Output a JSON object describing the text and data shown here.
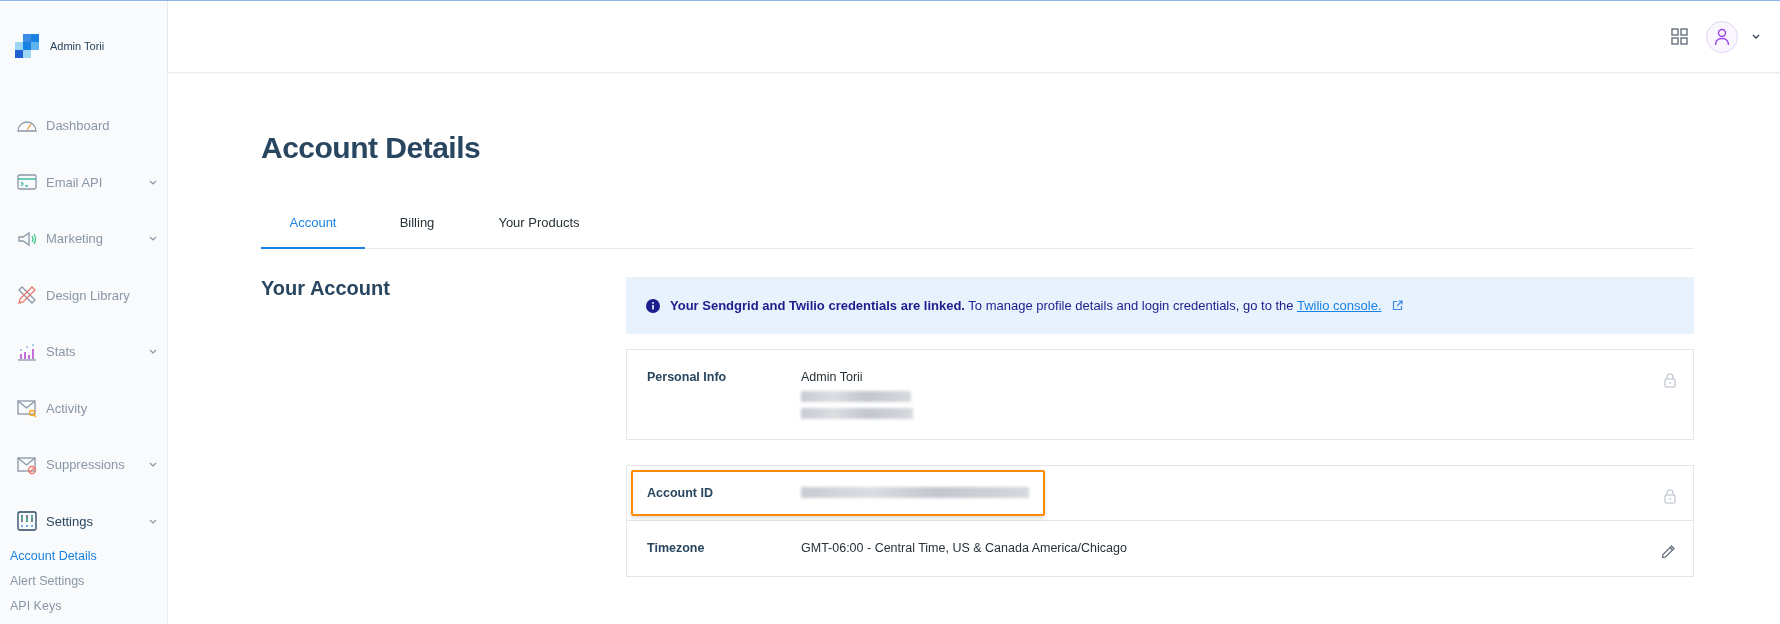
{
  "brand": {
    "name": "Admin Torii"
  },
  "sidebar": {
    "items": [
      {
        "label": "Dashboard",
        "expandable": false,
        "expanded": false
      },
      {
        "label": "Email API",
        "expandable": true,
        "expanded": false
      },
      {
        "label": "Marketing",
        "expandable": true,
        "expanded": false
      },
      {
        "label": "Design Library",
        "expandable": false,
        "expanded": false
      },
      {
        "label": "Stats",
        "expandable": true,
        "expanded": false
      },
      {
        "label": "Activity",
        "expandable": false,
        "expanded": false
      },
      {
        "label": "Suppressions",
        "expandable": true,
        "expanded": false
      },
      {
        "label": "Settings",
        "expandable": true,
        "expanded": true,
        "children": [
          {
            "label": "Account Details",
            "selected": true
          },
          {
            "label": "Alert Settings",
            "selected": false
          },
          {
            "label": "API Keys",
            "selected": false
          }
        ]
      }
    ]
  },
  "page": {
    "title": "Account Details"
  },
  "tabs": [
    {
      "label": "Account",
      "selected": true
    },
    {
      "label": "Billing",
      "selected": false
    },
    {
      "label": "Your Products",
      "selected": false
    }
  ],
  "section": {
    "title": "Your Account"
  },
  "banner": {
    "bold": "Your Sendgrid and Twilio credentials are linked.",
    "text": "To manage profile details and login credentials, go to the",
    "link": "Twilio console."
  },
  "cards": [
    {
      "rows": [
        {
          "label": "Personal Info",
          "lines": [
            "Admin Torii"
          ],
          "kind": "locked",
          "highlighted": false
        }
      ]
    },
    {
      "rows": [
        {
          "label": "Account ID",
          "lines": [],
          "kind": "locked",
          "highlighted": true
        },
        {
          "label": "Timezone",
          "lines": [
            "GMT-06:00 - Central Time, US & Canada America/Chicago"
          ],
          "kind": "editable",
          "highlighted": false
        }
      ]
    }
  ]
}
